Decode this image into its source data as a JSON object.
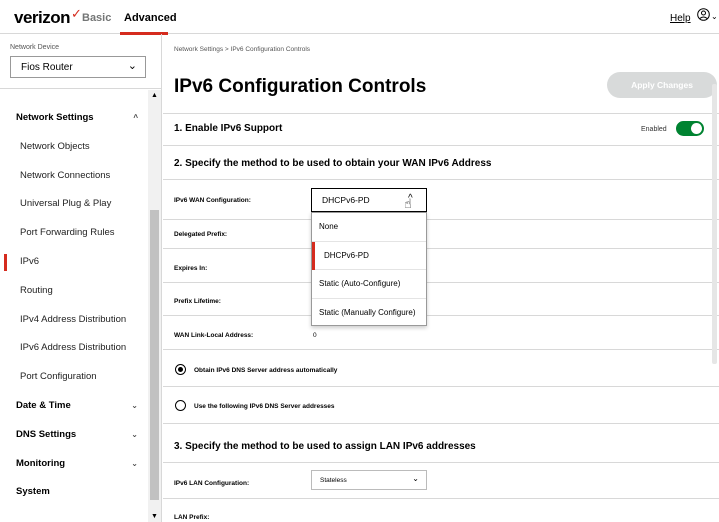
{
  "header": {
    "logo": "verizon",
    "logo_mark": "✓",
    "tabs": [
      {
        "label": "Basic",
        "active": false
      },
      {
        "label": "Advanced",
        "active": true
      }
    ],
    "help_label": "Help",
    "user_icon": "user-circle-icon",
    "accent_color": "#d52b1e"
  },
  "sidebar": {
    "device_label": "Network Device",
    "device_value": "Fios Router",
    "items": [
      {
        "label": "Network Settings",
        "type": "head",
        "expanded": true
      },
      {
        "label": "Network Objects",
        "type": "item"
      },
      {
        "label": "Network Connections",
        "type": "item"
      },
      {
        "label": "Universal Plug & Play",
        "type": "item"
      },
      {
        "label": "Port Forwarding Rules",
        "type": "item"
      },
      {
        "label": "IPv6",
        "type": "item",
        "active": true
      },
      {
        "label": "Routing",
        "type": "item"
      },
      {
        "label": "IPv4 Address Distribution",
        "type": "item"
      },
      {
        "label": "IPv6 Address Distribution",
        "type": "item"
      },
      {
        "label": "Port Configuration",
        "type": "item"
      },
      {
        "label": "Date & Time",
        "type": "head",
        "expanded": false
      },
      {
        "label": "DNS Settings",
        "type": "head",
        "expanded": false
      },
      {
        "label": "Monitoring",
        "type": "head",
        "expanded": false
      },
      {
        "label": "System",
        "type": "head",
        "expanded": false
      }
    ]
  },
  "main": {
    "breadcrumb": "Network Settings  >  IPv6 Configuration Controls",
    "title": "IPv6 Configuration Controls",
    "apply_label": "Apply Changes",
    "section1": {
      "title": "1. Enable IPv6 Support",
      "toggle_label": "Enabled",
      "toggle_on": true,
      "toggle_color": "#008331"
    },
    "section2": {
      "title": "2. Specify the method to be used to obtain your WAN IPv6 Address",
      "wan_config_label": "IPv6 WAN Configuration:",
      "wan_config_value": "DHCPv6-PD",
      "delegated_prefix_label": "Delegated Prefix:",
      "expires_label": "Expires In:",
      "prefix_lifetime_label": "Prefix Lifetime:",
      "link_local_label": "WAN Link-Local Address:",
      "link_local_value": "0",
      "dropdown_options": [
        "None",
        "DHCPv6-PD",
        "Static (Auto-Configure)",
        "Static (Manually Configure)"
      ],
      "dns_auto_label": "Obtain IPv6 DNS Server address automatically",
      "dns_manual_label": "Use the following IPv6 DNS Server addresses"
    },
    "section3": {
      "title": "3. Specify the method to be used to assign LAN IPv6 addresses",
      "lan_config_label": "IPv6 LAN Configuration:",
      "lan_config_value": "Stateless",
      "lan_prefix_label": "LAN Prefix:"
    }
  }
}
